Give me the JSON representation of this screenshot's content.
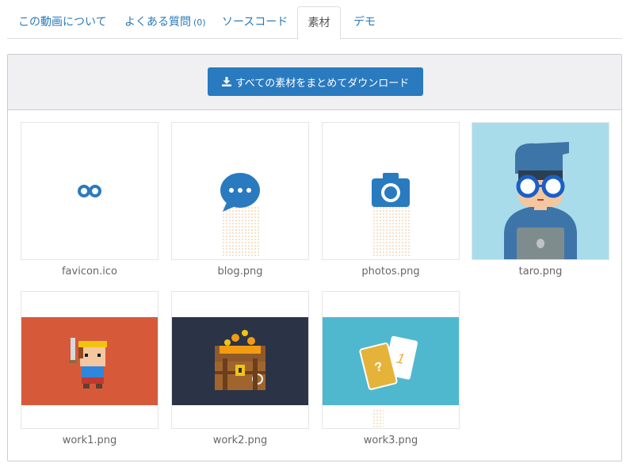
{
  "tabs": [
    {
      "label": "この動画について"
    },
    {
      "label": "よくある質問",
      "count": "(0)"
    },
    {
      "label": "ソースコード"
    },
    {
      "label": "素材",
      "active": true
    },
    {
      "label": "デモ"
    }
  ],
  "download_button": {
    "label": "すべての素材をまとめてダウンロード",
    "icon": "download-icon"
  },
  "assets": [
    {
      "name": "favicon.ico",
      "icon": "infinity-icon"
    },
    {
      "name": "blog.png",
      "icon": "chat-bubble-icon"
    },
    {
      "name": "photos.png",
      "icon": "camera-icon"
    },
    {
      "name": "taro.png",
      "icon": "character-illustration"
    },
    {
      "name": "work1.png",
      "icon": "pixel-hero-illustration"
    },
    {
      "name": "work2.png",
      "icon": "treasure-chest-illustration"
    },
    {
      "name": "work3.png",
      "icon": "cards-illustration"
    }
  ],
  "colors": {
    "accent": "#2a7ac0",
    "link": "#2a7ab9"
  },
  "card_text": {
    "question": "?",
    "one": "1"
  }
}
